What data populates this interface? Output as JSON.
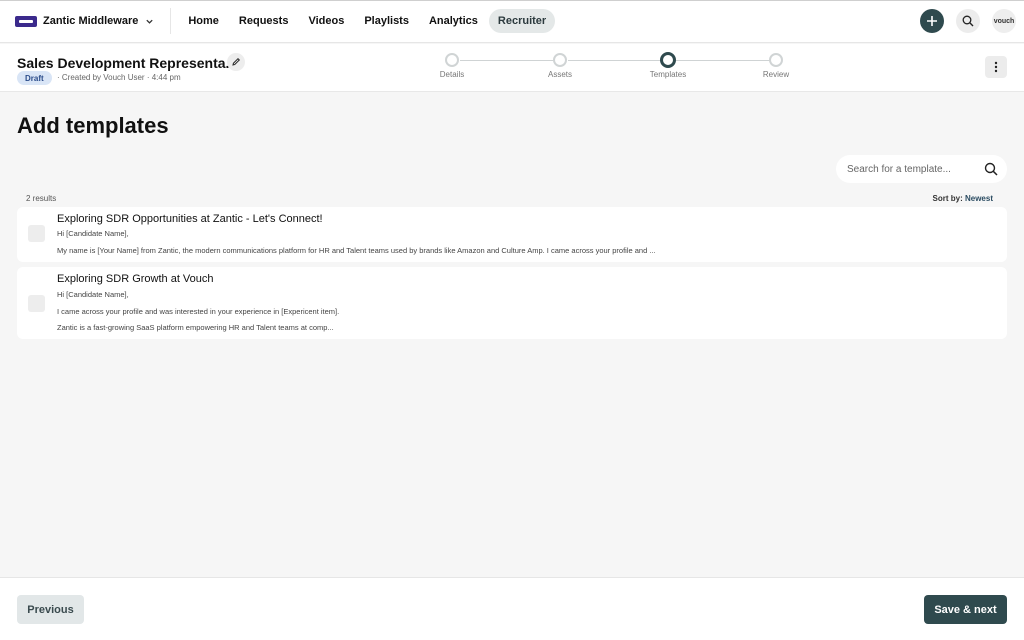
{
  "nav": {
    "org_name": "Zantic Middleware",
    "items": [
      {
        "label": "Home",
        "active": false
      },
      {
        "label": "Requests",
        "active": false
      },
      {
        "label": "Videos",
        "active": false
      },
      {
        "label": "Playlists",
        "active": false
      },
      {
        "label": "Analytics",
        "active": false
      },
      {
        "label": "Recruiter",
        "active": true
      }
    ],
    "avatar_text": "vouch",
    "icons": {
      "add": "plus-icon",
      "search": "search-icon",
      "org": "chevron-down-icon"
    }
  },
  "header": {
    "job_title": "Sales Development Representa...",
    "status_badge": "Draft",
    "meta": "· Created by Vouch User · 4:44 pm",
    "steps": [
      {
        "label": "Details",
        "current": false
      },
      {
        "label": "Assets",
        "current": false
      },
      {
        "label": "Templates",
        "current": true
      },
      {
        "label": "Review",
        "current": false
      }
    ]
  },
  "main": {
    "page_title": "Add templates",
    "search_placeholder": "Search for a template...",
    "results_count": "2 results",
    "sort_label": "Sort by:",
    "sort_value": "Newest",
    "templates": [
      {
        "title": "Exploring SDR Opportunities at Zantic - Let's Connect!",
        "lines": [
          "Hi [Candidate Name],",
          "My name is [Your Name] from Zantic, the modern communications platform for HR and Talent teams used by brands like Amazon and Culture Amp. I came across your profile and ..."
        ]
      },
      {
        "title": "Exploring SDR Growth at Vouch",
        "lines": [
          "Hi [Candidate Name],",
          "I came across your profile and was interested in your experience in [Expericent item].",
          "Zantic is a fast-growing SaaS platform empowering HR and Talent teams at comp..."
        ]
      }
    ]
  },
  "footer": {
    "previous_label": "Previous",
    "next_label": "Save & next"
  },
  "colors": {
    "primary": "#2f4a4e",
    "draft_badge_bg": "#d9e5f6",
    "page_bg": "#f6f6f6"
  }
}
